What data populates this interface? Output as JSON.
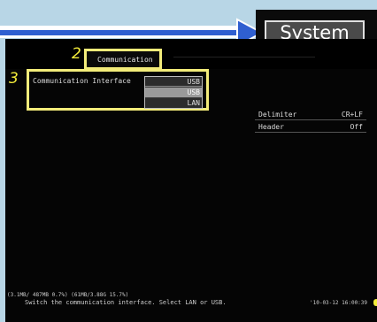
{
  "system_tab": {
    "label": "System"
  },
  "callouts": {
    "two": "2",
    "three": "3"
  },
  "tab": {
    "label": "Communication"
  },
  "interface": {
    "label": "Communication Interface",
    "options": [
      "USB",
      "USB",
      "LAN"
    ],
    "selected": "USB"
  },
  "settings": {
    "delimiter": {
      "label": "Delimiter",
      "value": "CR+LF"
    },
    "header": {
      "label": "Header",
      "value": "Off"
    }
  },
  "status": {
    "memory": "(3.1MB/ 487MB 0.7%)  (61MB/3.88G 15.7%)",
    "message": "Switch the communication interface. Select LAN or USB.",
    "time": "'10-03-12 16:00:39"
  },
  "colors": {
    "highlight": "#f3ec7a",
    "arrow": "#2f5fd0",
    "background": "#b8d6e6",
    "screen": "#050505"
  }
}
